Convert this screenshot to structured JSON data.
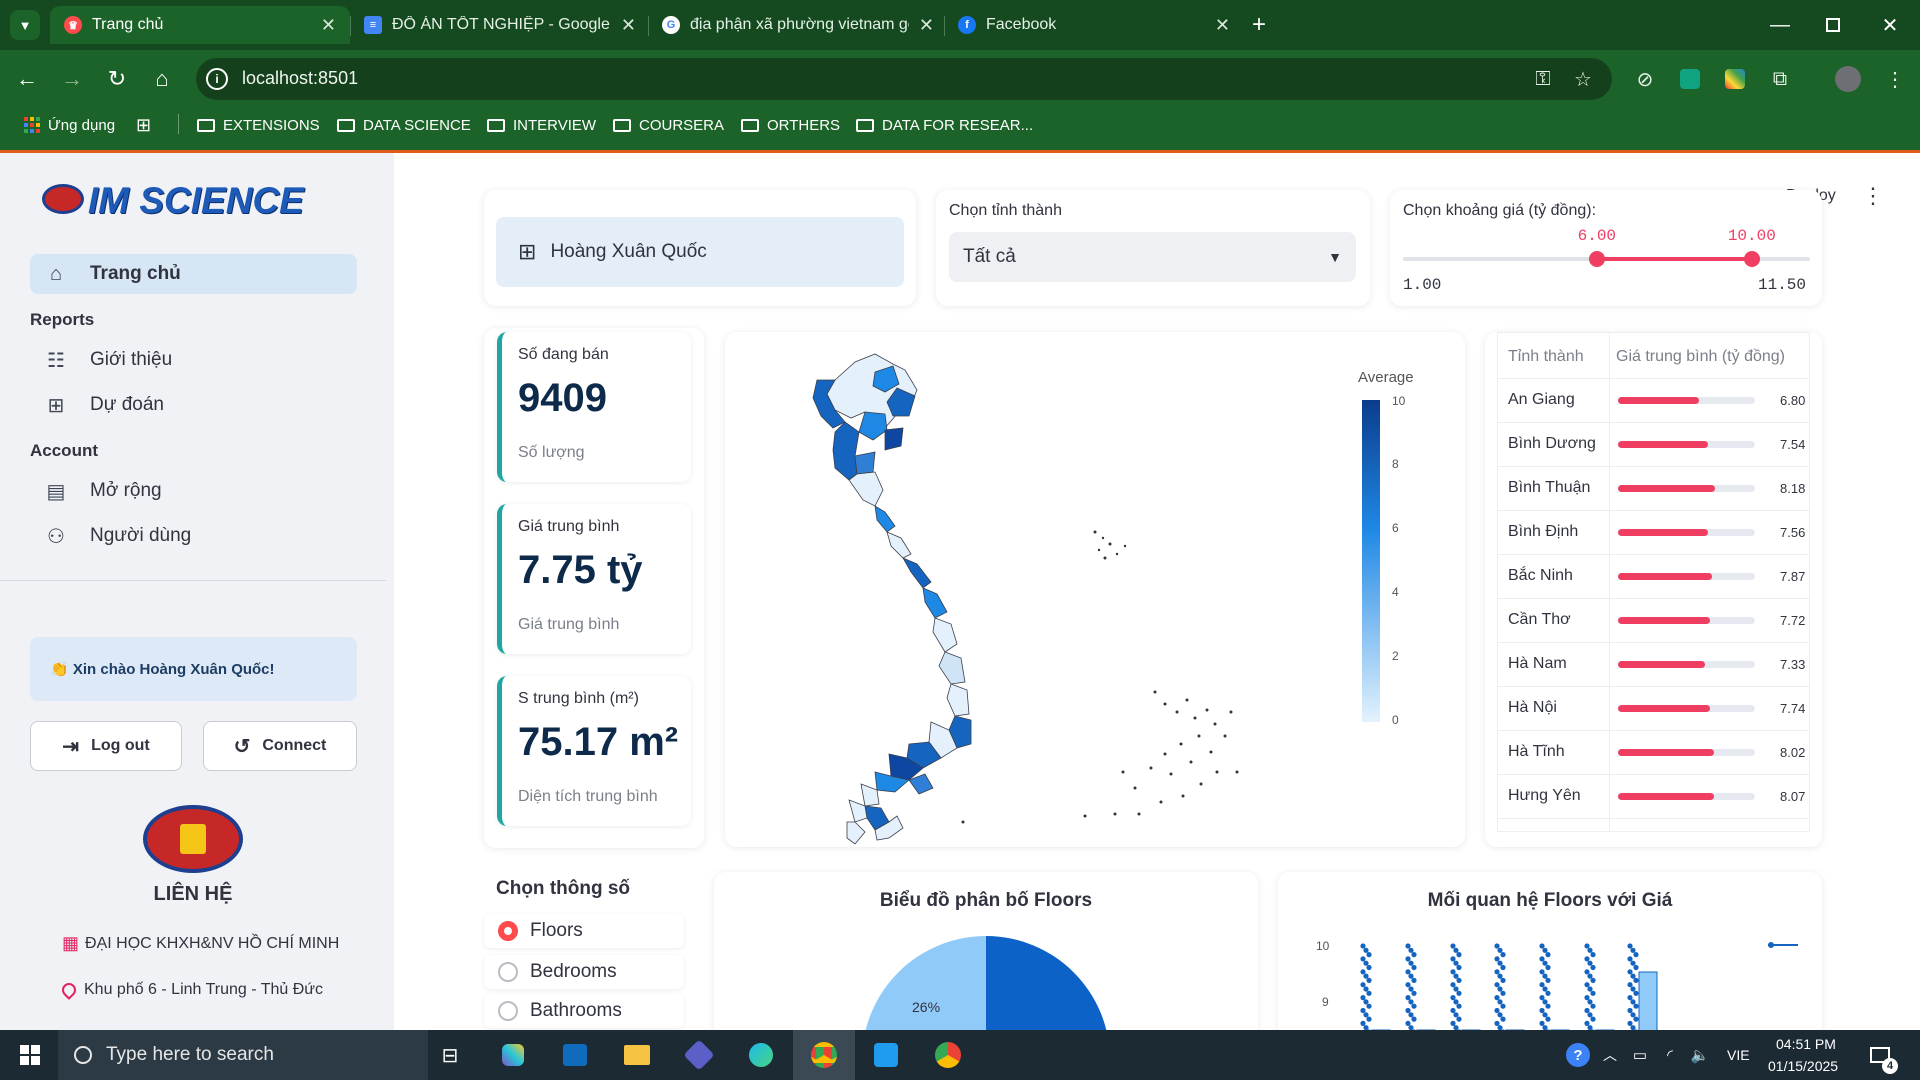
{
  "browser": {
    "tabs": [
      {
        "label": "Trang chủ",
        "favicon": "streamlit-icon",
        "color": "#ff4b4b",
        "active": true
      },
      {
        "label": "ĐỒ ÁN TỐT NGHIỆP - Google Tài liệu",
        "favicon": "docs-icon",
        "color": "#4285f4"
      },
      {
        "label": "địa phận xã phường vietnam ge",
        "favicon": "google-icon",
        "color": "#ffffff"
      },
      {
        "label": "Facebook",
        "favicon": "facebook-icon",
        "color": "#1877f2"
      }
    ],
    "url": "localhost:8501",
    "bookmarks": [
      {
        "label": "Ứng dụng",
        "icon": "apps-grid-icon"
      },
      {
        "label": "EXTENSIONS",
        "icon": "folder-icon"
      },
      {
        "label": "DATA SCIENCE",
        "icon": "folder-icon"
      },
      {
        "label": "INTERVIEW",
        "icon": "folder-icon"
      },
      {
        "label": "COURSERA",
        "icon": "folder-icon"
      },
      {
        "label": "ORTHERS",
        "icon": "folder-icon"
      },
      {
        "label": "DATA FOR RESEAR...",
        "icon": "folder-icon"
      }
    ]
  },
  "sidebar": {
    "brand": "IM SCIENCE",
    "home": "Trang chủ",
    "reports_title": "Reports",
    "reports_items": [
      "Giới thiệu",
      "Dự đoán"
    ],
    "account_title": "Account",
    "account_items": [
      "Mở rộng",
      "Người dùng"
    ],
    "greeting": "👏 Xin chào Hoàng Xuân Quốc!",
    "logout": "Log out",
    "connect": "Connect",
    "contact_title": "LIÊN HỆ",
    "university": "ĐẠI HỌC KHXH&NV HỒ CHÍ MINH",
    "address": "Khu phố 6 - Linh Trung - Thủ Đức"
  },
  "header": {
    "user": "Hoàng Xuân Quốc",
    "province_label": "Chọn tỉnh thành",
    "province_value": "Tất cả",
    "price_label": "Chọn khoảng giá (tỷ đồng):",
    "price_min": "1.00",
    "price_max": "11.50",
    "price_low": "6.00",
    "price_high": "10.00",
    "price_low_frac": 0.4762,
    "price_high_frac": 0.8571,
    "deploy": "Deploy"
  },
  "metrics": [
    {
      "label": "Số đang bán",
      "value": "9409",
      "sub": "Số lượng"
    },
    {
      "label": "Giá trung bình",
      "value": "7.75 tỷ",
      "sub": "Giá trung bình"
    },
    {
      "label": "S trung bình (m²)",
      "value": "75.17 m²",
      "sub": "Diện tích trung bình"
    }
  ],
  "map": {
    "colorbar_title": "Average",
    "ticks": [
      "10",
      "8",
      "6",
      "4",
      "2",
      "0"
    ]
  },
  "table": {
    "col1": "Tỉnh thành",
    "col2": "Giá trung bình (tỷ đồng)",
    "max": 11.5,
    "rows": [
      {
        "name": "An Giang",
        "value": 6.8
      },
      {
        "name": "Bình Dương",
        "value": 7.54
      },
      {
        "name": "Bình Thuận",
        "value": 8.18
      },
      {
        "name": "Bình Định",
        "value": 7.56
      },
      {
        "name": "Bắc Ninh",
        "value": 7.87
      },
      {
        "name": "Cần Thơ",
        "value": 7.72
      },
      {
        "name": "Hà Nam",
        "value": 7.33
      },
      {
        "name": "Hà Nội",
        "value": 7.74
      },
      {
        "name": "Hà Tĩnh",
        "value": 8.02
      },
      {
        "name": "Hưng Yên",
        "value": 8.07
      }
    ]
  },
  "param": {
    "title": "Chọn thông số",
    "options": [
      "Floors",
      "Bedrooms",
      "Bathrooms"
    ],
    "selected": "Floors"
  },
  "charts": {
    "pie_title": "Biểu đồ phân bố Floors",
    "pie_label": "26%",
    "box_title": "Mối quan hệ Floors với Giá",
    "box_ticks": [
      "10",
      "9"
    ]
  },
  "taskbar": {
    "search_placeholder": "Type here to search",
    "lang": "VIE",
    "time": "04:51 PM",
    "date": "01/15/2025",
    "notif": "4"
  }
}
